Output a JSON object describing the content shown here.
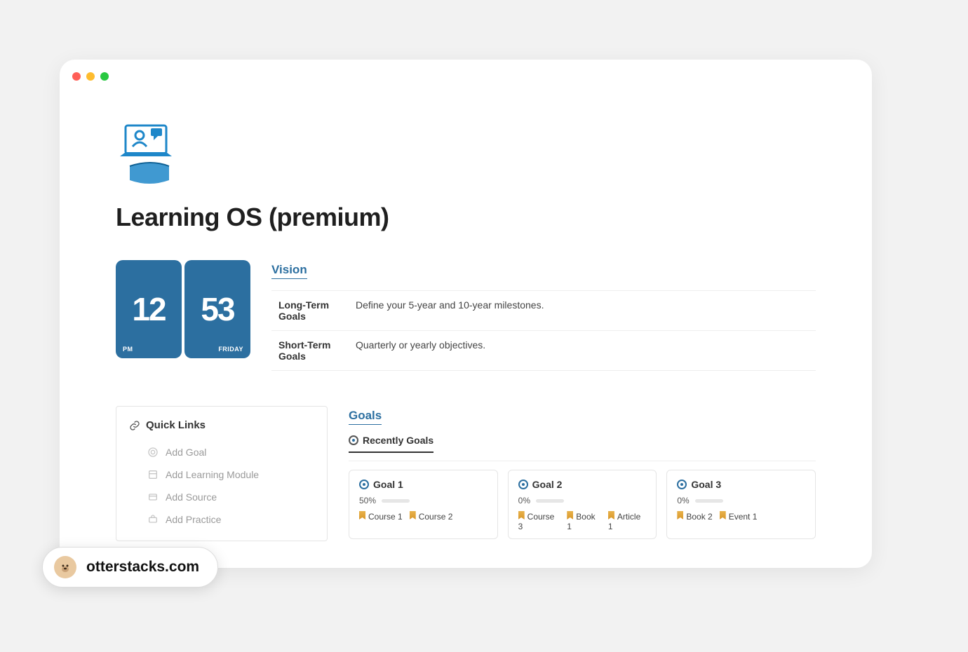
{
  "page": {
    "title": "Learning OS (premium)"
  },
  "clock": {
    "hours": "12",
    "minutes": "53",
    "ampm": "PM",
    "day": "Friday"
  },
  "vision": {
    "heading": "Vision",
    "rows": [
      {
        "label": "Long-Term Goals",
        "value": "Define your 5-year and 10-year milestones."
      },
      {
        "label": "Short-Term Goals",
        "value": "Quarterly or yearly objectives."
      }
    ]
  },
  "quicklinks": {
    "heading": "Quick Links",
    "items": [
      {
        "label": "Add Goal"
      },
      {
        "label": "Add Learning Module"
      },
      {
        "label": "Add Source"
      },
      {
        "label": "Add Practice"
      }
    ]
  },
  "goals": {
    "heading": "Goals",
    "tab": "Recently Goals",
    "cards": [
      {
        "title": "Goal 1",
        "pct": "50%",
        "fill": 50,
        "tags": [
          "Course 1",
          "Course 2"
        ]
      },
      {
        "title": "Goal 2",
        "pct": "0%",
        "fill": 0,
        "tags": [
          "Course 3",
          "Book 1",
          "Article 1"
        ]
      },
      {
        "title": "Goal 3",
        "pct": "0%",
        "fill": 0,
        "tags": [
          "Book 2",
          "Event 1"
        ]
      }
    ]
  },
  "brand": {
    "label": "otterstacks.com"
  }
}
